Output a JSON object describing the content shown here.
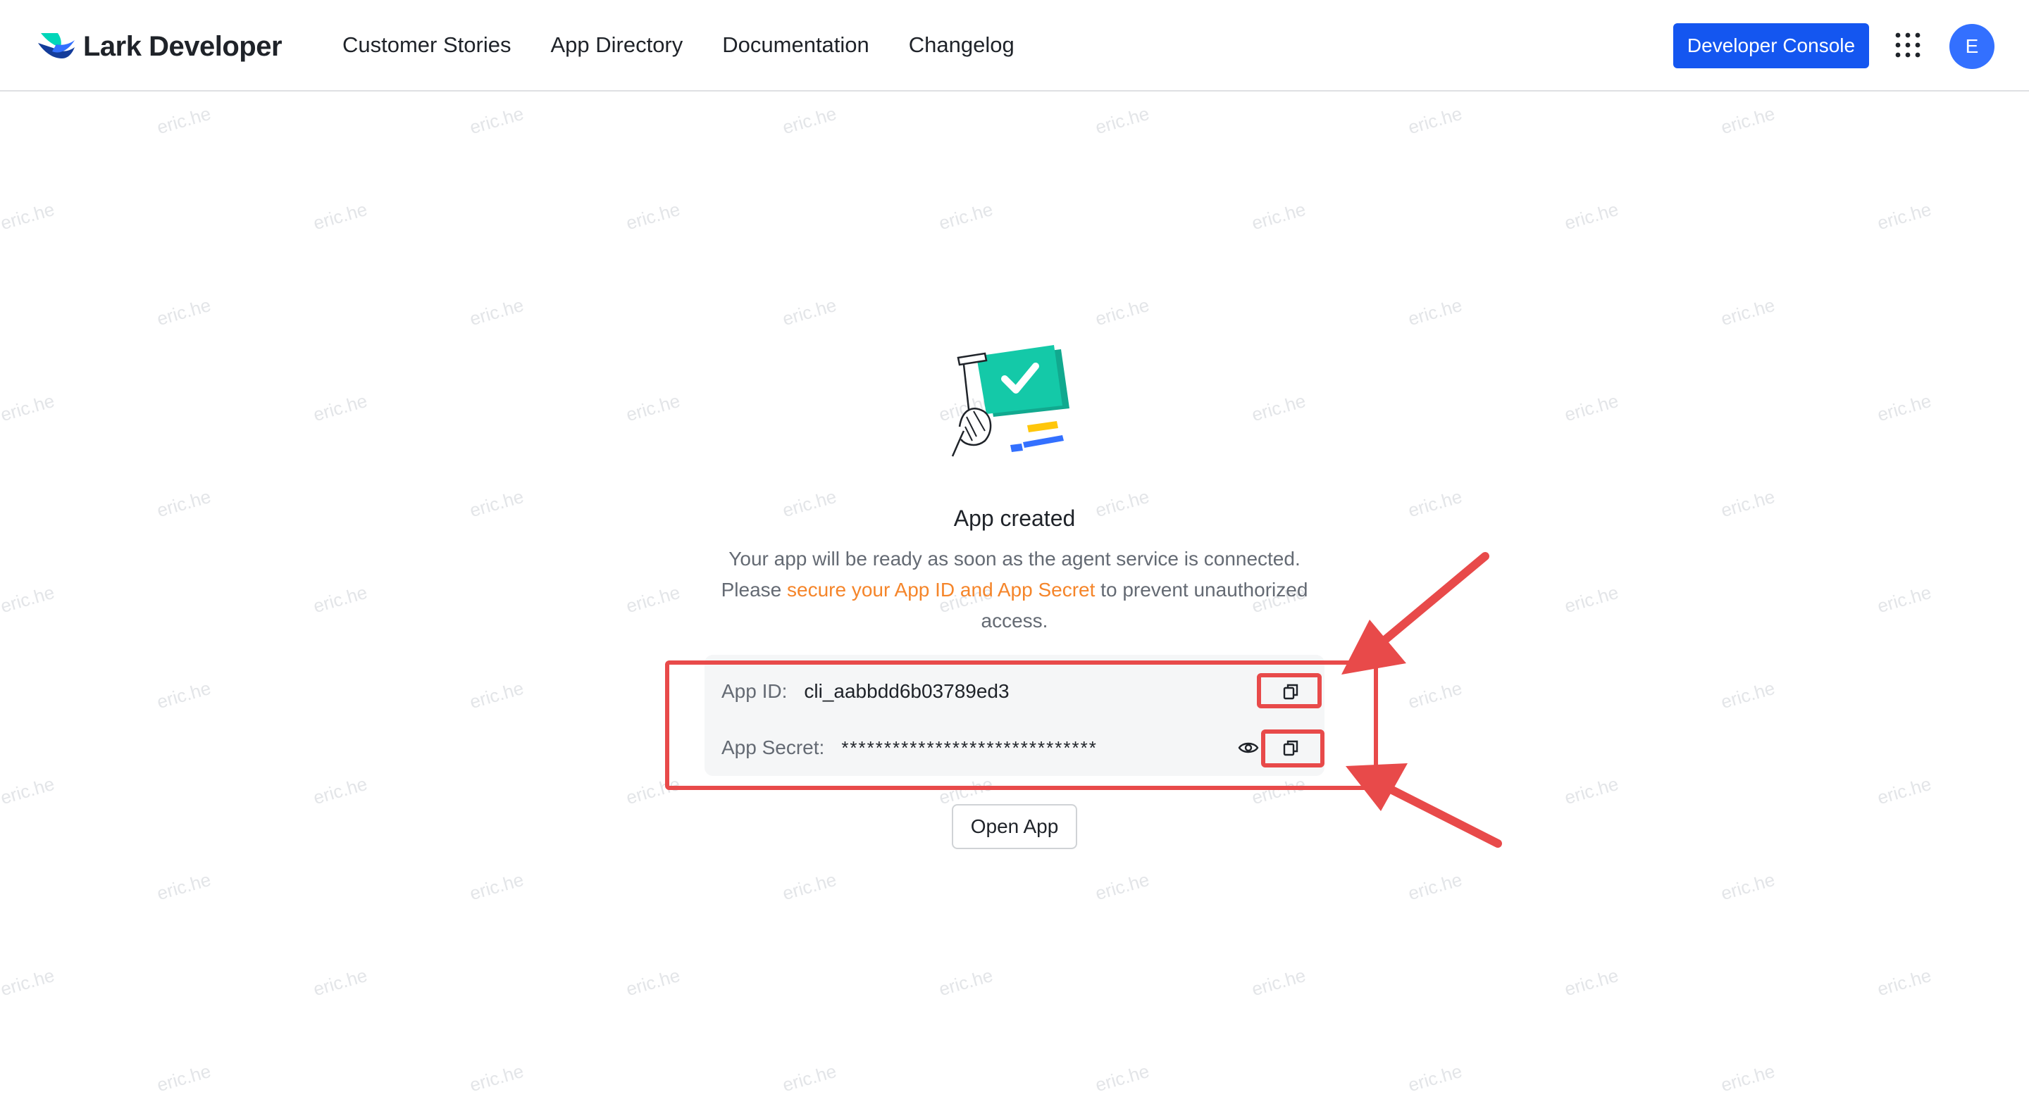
{
  "watermark_text": "eric.he",
  "header": {
    "logo_text": "Lark Developer",
    "nav": [
      {
        "label": "Customer Stories"
      },
      {
        "label": "App Directory"
      },
      {
        "label": "Documentation"
      },
      {
        "label": "Changelog"
      }
    ],
    "console_label": "Developer Console",
    "avatar_initial": "E"
  },
  "main": {
    "title": "App created",
    "desc_line1": "Your app will be ready as soon as the agent service is connected.",
    "desc_prefix": "Please ",
    "desc_link": "secure your App ID and App Secret",
    "desc_suffix": " to prevent unauthorized access.",
    "app_id_label": "App ID:",
    "app_id_value": "cli_aabbdd6b03789ed3",
    "app_secret_label": "App Secret:",
    "app_secret_value": "******************************",
    "open_app_label": "Open App"
  },
  "colors": {
    "brand_blue": "#1456f0",
    "link_orange": "#f5852a",
    "annotation_red": "#e84a4a",
    "check_teal": "#14c9a8"
  },
  "icons": [
    "lark-logo-icon",
    "apps-grid-icon",
    "copy-icon",
    "eye-icon",
    "app-created-illustration"
  ]
}
